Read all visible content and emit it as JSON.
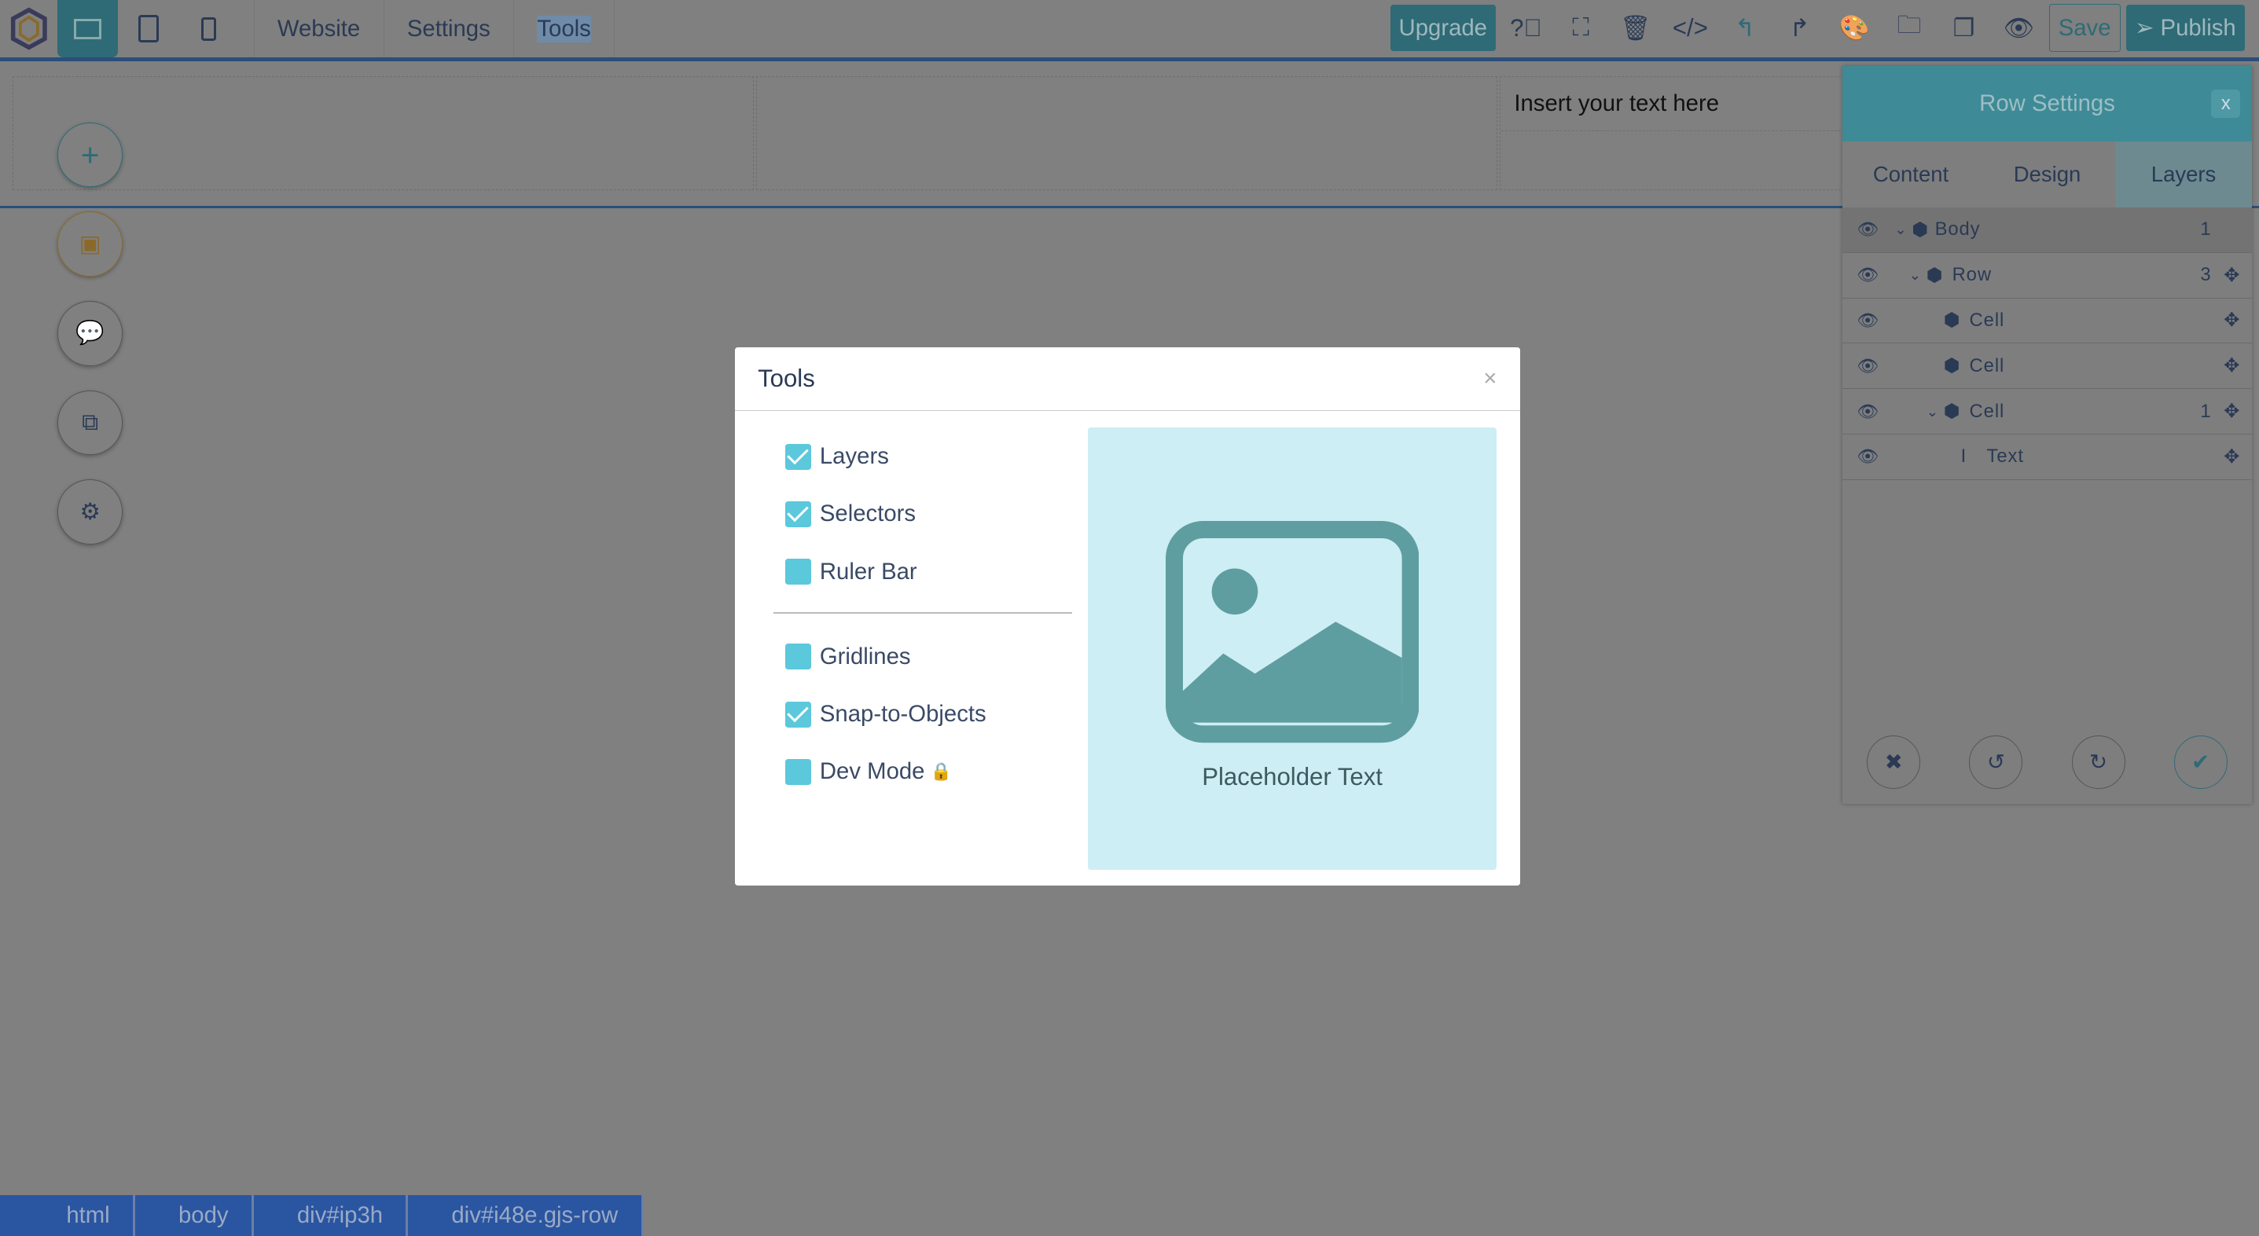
{
  "toolbar": {
    "menus": [
      "Website",
      "Settings",
      "Tools"
    ],
    "upgrade": "Upgrade",
    "save": "Save",
    "publish": "Publish"
  },
  "canvas": {
    "text": "Insert your text here"
  },
  "row_settings": {
    "title": "Row Settings",
    "close": "x",
    "tabs": [
      "Content",
      "Design",
      "Layers"
    ],
    "active_tab": "Layers",
    "layers": [
      {
        "name": "Body",
        "count": "1"
      },
      {
        "name": "Row",
        "count": "3"
      },
      {
        "name": "Cell",
        "count": ""
      },
      {
        "name": "Cell",
        "count": ""
      },
      {
        "name": "Cell",
        "count": "1"
      },
      {
        "name": "Text",
        "count": ""
      }
    ]
  },
  "breadcrumb": [
    "html",
    "body",
    "div#ip3h",
    "div#i48e.gjs-row"
  ],
  "modal": {
    "title": "Tools",
    "close": "×",
    "options": [
      {
        "label": "Layers",
        "checked": true
      },
      {
        "label": "Selectors",
        "checked": true
      },
      {
        "label": "Ruler Bar",
        "checked": false
      },
      {
        "label": "Gridlines",
        "checked": false
      },
      {
        "label": "Snap-to-Objects",
        "checked": true
      },
      {
        "label": "Dev Mode",
        "checked": false,
        "locked": true
      }
    ],
    "preview_text": "Placeholder Text"
  },
  "colors": {
    "accent": "#5bc8dc",
    "teal": "#2e6b76",
    "breadcrumb": "#2a55a0"
  }
}
